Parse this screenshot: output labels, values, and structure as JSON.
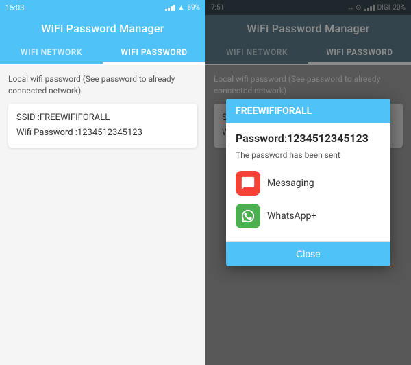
{
  "left": {
    "status": {
      "time": "15:03",
      "signal": "wifi",
      "battery": "69%"
    },
    "header": "WiFi Password Manager",
    "tabs": [
      {
        "label": "WIFI NETWORK",
        "active": false
      },
      {
        "label": "WIFI PASSWORD",
        "active": true
      }
    ],
    "subtitle": "Local wifi password (See password to already connected network)",
    "ssid_label": "SSID :FREEWIFIFORALL",
    "password_label": "Wifi Password :1234512345123"
  },
  "right": {
    "status": {
      "time": "7:51",
      "carrier": "DIGI",
      "battery": "20%"
    },
    "header": "WiFi Password Manager",
    "tabs": [
      {
        "label": "WIFI NETWORK",
        "active": false
      },
      {
        "label": "WIFI PASSWORD",
        "active": true
      }
    ],
    "subtitle": "Local wifi password (See password to already connected network)",
    "ssid_label": "SSID :FREEWIFIFORALL",
    "password_partial": "Wifi Pass...",
    "dialog": {
      "title": "FREEWIFIFORALL",
      "password": "Password:1234512345123",
      "sent_text": "The password has been sent",
      "apps": [
        {
          "name": "Messaging",
          "icon": "messaging"
        },
        {
          "name": "WhatsApp+",
          "icon": "whatsapp"
        }
      ],
      "close_label": "Close"
    }
  }
}
